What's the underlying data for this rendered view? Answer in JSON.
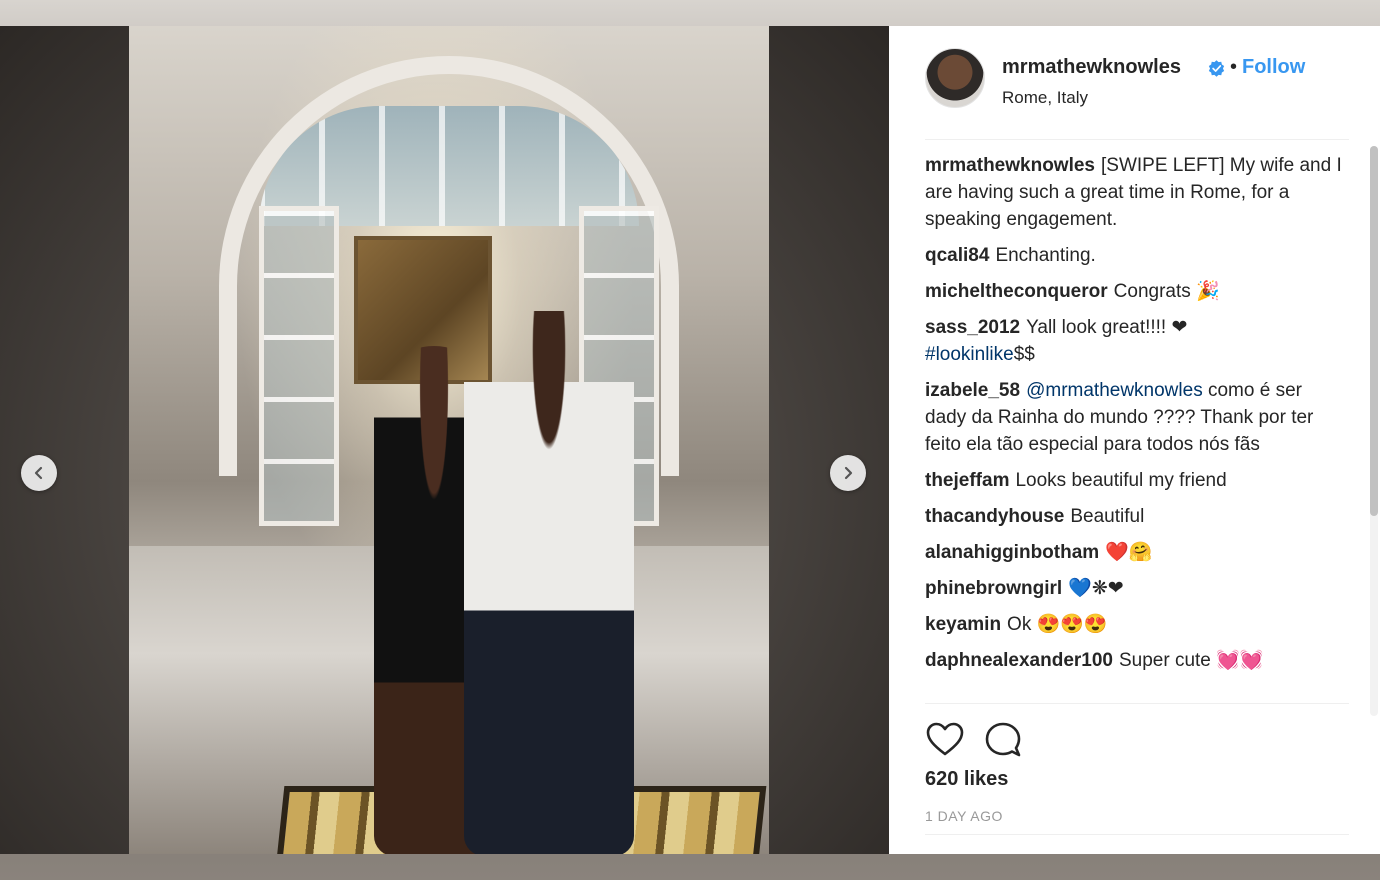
{
  "post": {
    "username": "mrmathewknowles",
    "verified_icon": "verified-badge-icon",
    "separator": "•",
    "follow_label": "Follow",
    "location": "Rome, Italy",
    "likes": "620 likes",
    "timestamp": "1 DAY AGO"
  },
  "caption": {
    "user": "mrmathewknowles",
    "text": "[SWIPE LEFT] My wife and I are having such a great time in Rome, for a speaking engagement."
  },
  "comments": [
    {
      "user": "qcali84",
      "text": "Enchanting."
    },
    {
      "user": "micheltheconqueror",
      "text": "Congrats 🎉"
    },
    {
      "user": "sass_2012",
      "text": "Yall look great!!!! ❤",
      "link": "#lookinlike",
      "after": "$$"
    },
    {
      "user": "izabele_58",
      "link": "@mrmathewknowles",
      "text": " como é ser dady da Rainha do mundo ???? Thank por ter feito ela tão especial para todos nós fãs"
    },
    {
      "user": "thejeffam",
      "text": "Looks beautiful my friend"
    },
    {
      "user": "thacandyhouse",
      "text": "Beautiful"
    },
    {
      "user": "alanahigginbotham",
      "text": "❤️🤗"
    },
    {
      "user": "phinebrowngirl",
      "text": "💙❋❤"
    },
    {
      "user": "keyamin",
      "text": "Ok 😍😍😍"
    },
    {
      "user": "daphnealexander100",
      "text": "Super cute 💓💓"
    }
  ],
  "colors": {
    "link_blue": "#3897f0",
    "hashtag_blue": "#003569",
    "text": "#262626",
    "muted": "#999999"
  },
  "icons": [
    "chevron-left-icon",
    "chevron-right-icon",
    "heart-icon",
    "comment-icon"
  ]
}
